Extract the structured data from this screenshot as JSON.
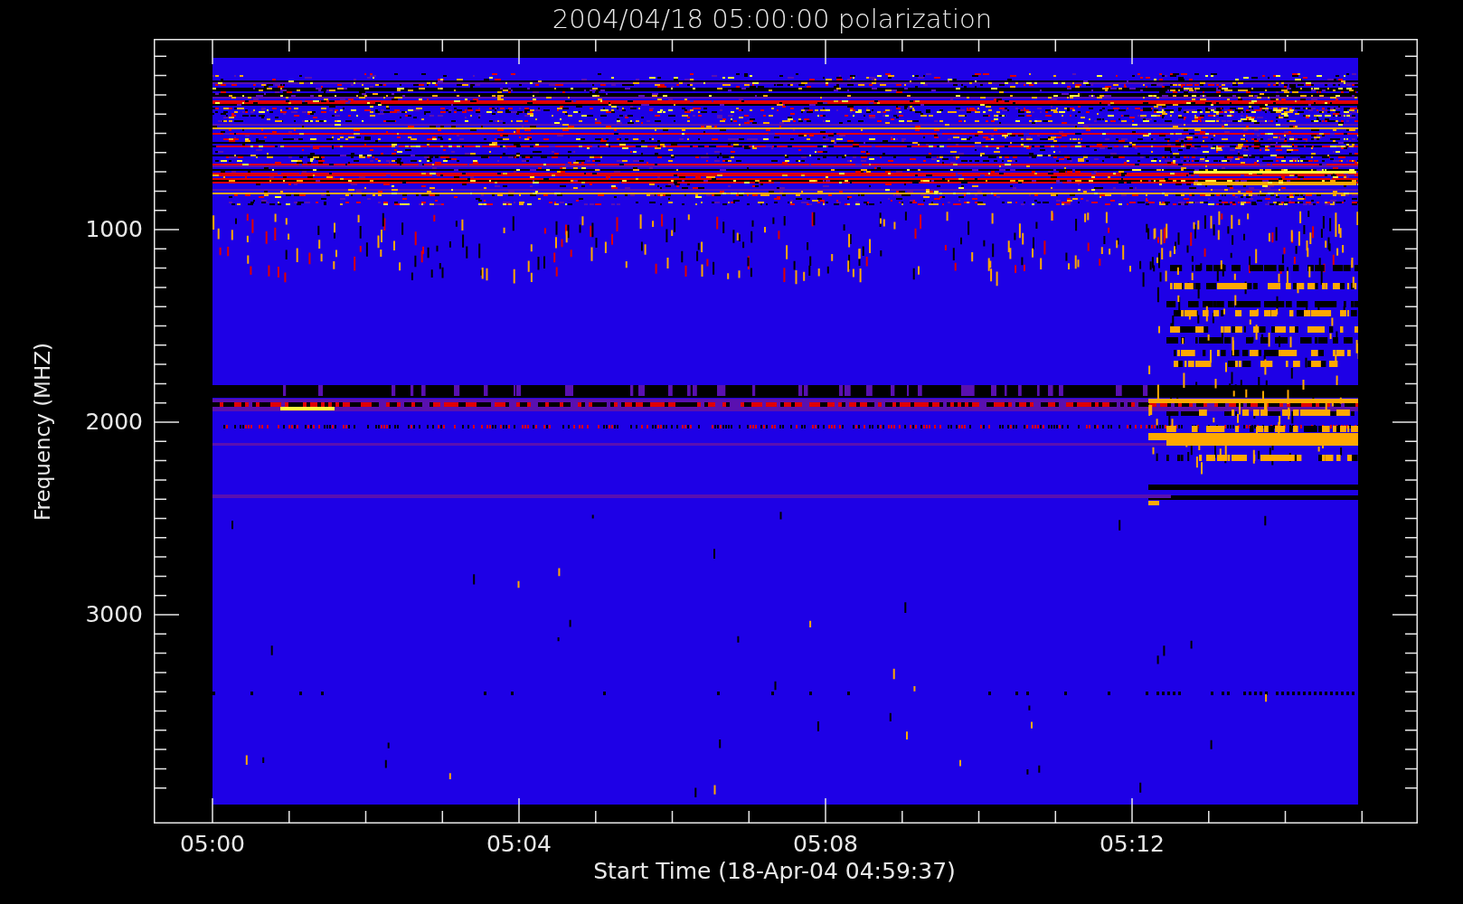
{
  "title": "2004/04/18 05:00:00 polarization",
  "y_axis": {
    "label": "Frequency (MHZ)",
    "ticks": [
      "1000",
      "2000",
      "3000"
    ]
  },
  "x_axis": {
    "label": "Start Time (18-Apr-04 04:59:37)",
    "ticks": [
      "05:00",
      "05:04",
      "05:08",
      "05:12"
    ]
  }
}
